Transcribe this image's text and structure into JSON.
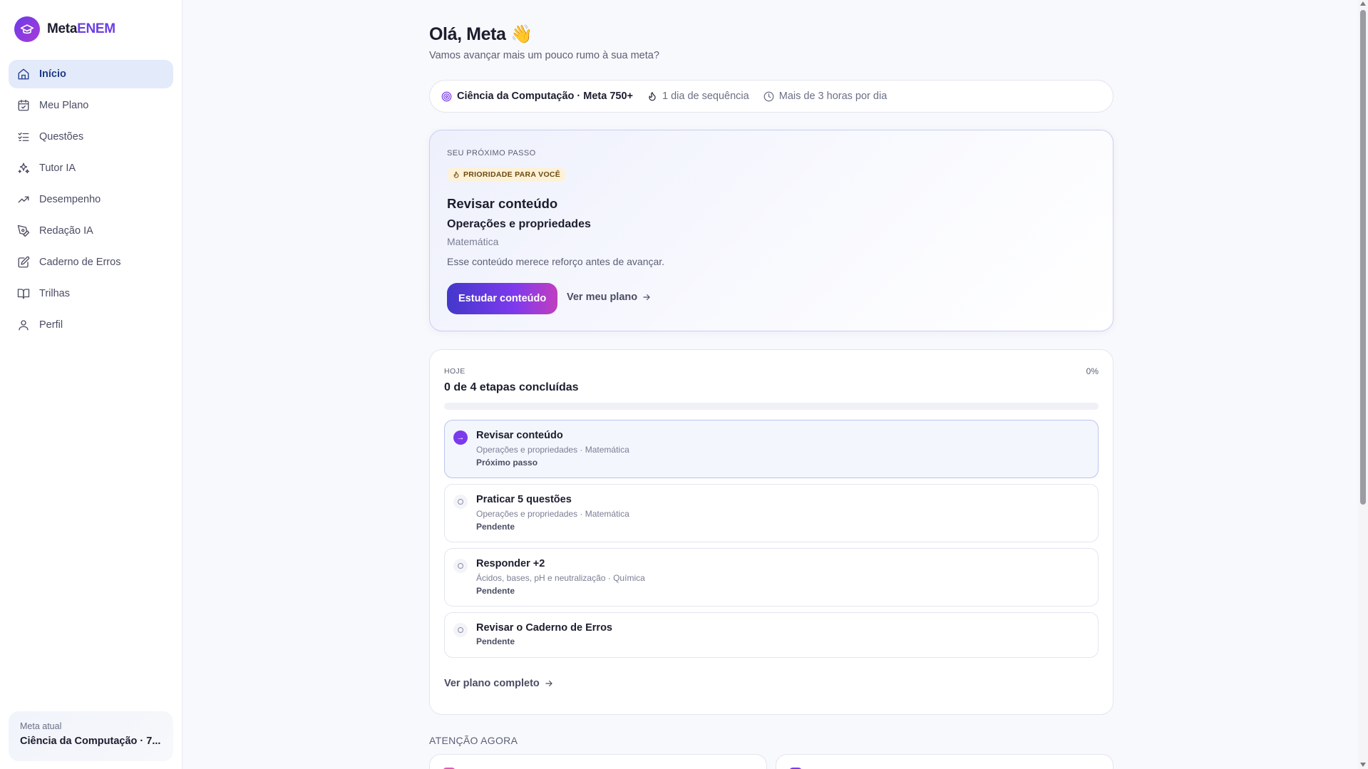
{
  "brand": {
    "name_prefix": "Meta",
    "name_accent": "ENEM",
    "accent_color": "#6b3ee6"
  },
  "sidebar": {
    "items": [
      {
        "label": "Início",
        "icon": "home-icon",
        "active": true
      },
      {
        "label": "Meu Plano",
        "icon": "calendar-icon"
      },
      {
        "label": "Questões",
        "icon": "list-check-icon"
      },
      {
        "label": "Tutor IA",
        "icon": "sparkles-icon"
      },
      {
        "label": "Desempenho",
        "icon": "trending-up-icon"
      },
      {
        "label": "Redação IA",
        "icon": "pen-tool-icon"
      },
      {
        "label": "Caderno de Erros",
        "icon": "notebook-edit-icon"
      },
      {
        "label": "Trilhas",
        "icon": "book-open-icon"
      },
      {
        "label": "Perfil",
        "icon": "user-icon"
      }
    ],
    "goal_label": "Meta atual",
    "goal_value": "Ciência da Computação · 7..."
  },
  "header": {
    "greeting": "Olá, Meta",
    "greeting_emoji": "👋",
    "subtitle": "Vamos avançar mais um pouco rumo à sua meta?"
  },
  "stats": {
    "goal": "Ciência da Computação · Meta 750+",
    "streak": "1 dia de sequência",
    "hours": "Mais de 3 horas por dia"
  },
  "next_step": {
    "eyebrow": "Seu próximo passo",
    "badge": "Prioridade para você",
    "title": "Revisar conteúdo",
    "topic": "Operações e propriedades",
    "subject": "Matemática",
    "description": "Esse conteúdo merece reforço antes de avançar.",
    "primary_button": "Estudar conteúdo",
    "secondary_link": "Ver meu plano"
  },
  "today": {
    "eyebrow": "Hoje",
    "percent": "0%",
    "progress": 0,
    "title": "0 de 4 etapas concluídas",
    "steps": [
      {
        "title": "Revisar conteúdo",
        "meta": "Operações e propriedades · Matemática",
        "status": "Próximo passo",
        "current": true
      },
      {
        "title": "Praticar 5 questões",
        "meta": "Operações e propriedades · Matemática",
        "status": "Pendente"
      },
      {
        "title": "Responder +2",
        "meta": "Ácidos, bases, pH e neutralização · Química",
        "status": "Pendente"
      },
      {
        "title": "Revisar o Caderno de Erros",
        "meta": "",
        "status": "Pendente"
      }
    ],
    "see_full": "Ver plano completo"
  },
  "attention": {
    "label": "Atenção agora"
  }
}
